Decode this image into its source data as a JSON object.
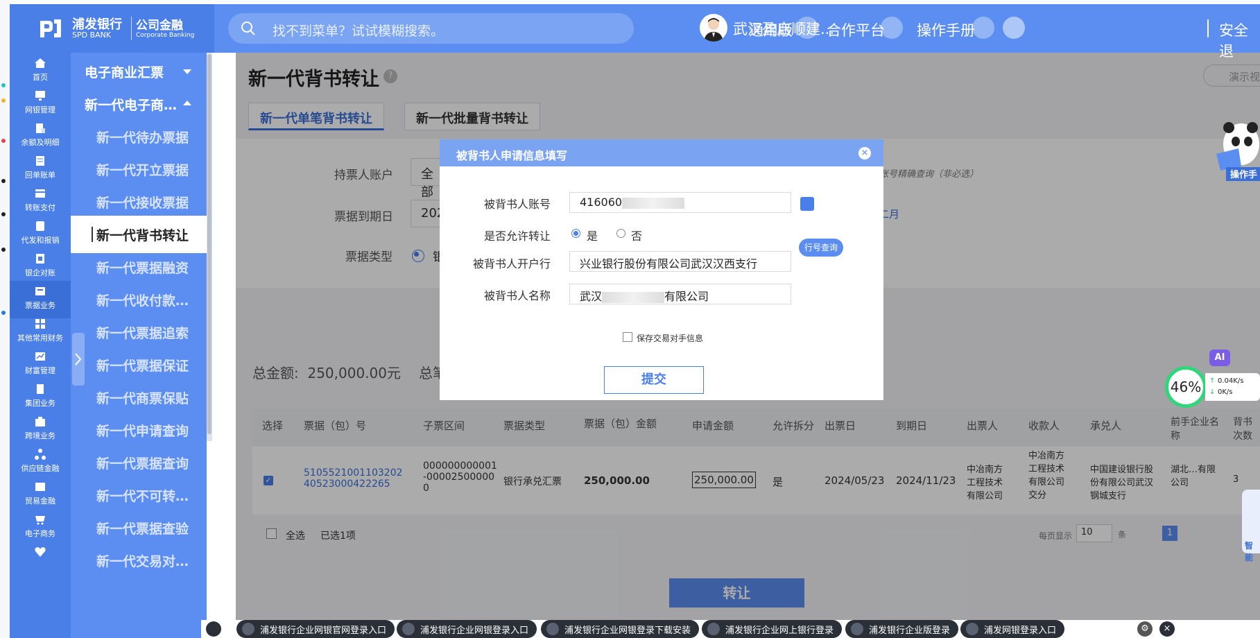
{
  "brand": {
    "name_cn": "浦发银行",
    "name_en": "SPD BANK",
    "sub_cn": "公司金融",
    "sub_en": "Corporate Banking"
  },
  "topbar": {
    "search_placeholder": "找不到菜单？试试模糊搜索。",
    "user_name": "武汉盈启顺建...",
    "version_label": "通用版",
    "partner_label": "合作平台",
    "manual_label": "操作手册",
    "logout_label": "安全退"
  },
  "icon_nav": [
    {
      "label": "首页",
      "icon": "home-icon"
    },
    {
      "label": "网银管理",
      "icon": "monitor-icon"
    },
    {
      "label": "余额及明细",
      "icon": "balance-icon"
    },
    {
      "label": "回单账单",
      "icon": "receipt-icon"
    },
    {
      "label": "转账支付",
      "icon": "transfer-icon"
    },
    {
      "label": "代发和报销",
      "icon": "payroll-icon"
    },
    {
      "label": "银企对账",
      "icon": "reconcile-icon"
    },
    {
      "label": "票据业务",
      "icon": "bill-icon"
    },
    {
      "label": "其他常用财务",
      "icon": "grid-icon"
    },
    {
      "label": "财富管理",
      "icon": "chart-icon"
    },
    {
      "label": "集团业务",
      "icon": "group-icon"
    },
    {
      "label": "跨境业务",
      "icon": "cross-border-icon"
    },
    {
      "label": "供应链金融",
      "icon": "supply-chain-icon"
    },
    {
      "label": "贸易金融",
      "icon": "trade-icon"
    },
    {
      "label": "电子商务",
      "icon": "ecommerce-icon"
    }
  ],
  "sub_nav": {
    "header": "电子商业汇票",
    "group": "新一代电子商…",
    "items": [
      "新一代待办票据",
      "新一代开立票据",
      "新一代接收票据",
      "新一代背书转让",
      "新一代票据融资",
      "新一代收付款…",
      "新一代票据追索",
      "新一代票据保证",
      "新一代商票保贴",
      "新一代申请查询",
      "新一代票据查询",
      "新一代不可转…",
      "新一代票据查验",
      "新一代交易对…"
    ]
  },
  "page": {
    "title": "新一代背书转让",
    "demo_label": "演示视",
    "tabs": [
      "新一代单笔背书转让",
      "新一代批量背书转让"
    ],
    "form": {
      "holder_account_label": "持票人账户",
      "holder_account_value": "全部",
      "due_date_label": "票据到期日",
      "due_date_value": "202",
      "bill_type_label": "票据类型",
      "bill_type_value": "银",
      "hint": "账号精确查询（非必选）",
      "month_hint": "二月"
    },
    "summary": {
      "total_label": "总金额:",
      "total_value": "250,000.00元",
      "count_label": "总笔"
    },
    "table": {
      "headers": [
        "选择",
        "票据（包）号",
        "子票区间",
        "票据类型",
        "票据（包）金额",
        "申请金额",
        "允许拆分",
        "出票日",
        "到期日",
        "出票人",
        "收款人",
        "承兑人",
        "前手企业名称",
        "背书次数"
      ],
      "row": {
        "bill_no": "510552100110320240523000422265",
        "range": "000000000001-000025000000",
        "bill_type": "银行承兑汇票",
        "amount": "250,000.00",
        "apply_amount": "250,000.00",
        "split": "是",
        "issue_date": "2024/05/23",
        "due_date": "2024/11/23",
        "drawer": "中冶南方工程技术有限公司",
        "payee": "中冶南方工程技术有限公司交分",
        "acceptor": "中国建设银行股份有限公司武汉钢城支行",
        "prior_holder": "湖北…有限公司",
        "endorse_count": "3"
      },
      "select_all": "全选",
      "selected_info": "已选1项",
      "page_size_label": "每页显示",
      "page_size_value": "10",
      "page_unit": "条",
      "current_page": "1"
    },
    "transfer_button": "转让"
  },
  "modal": {
    "title": "被背书人申请信息填写",
    "account_label": "被背书人账号",
    "account_value": "416060",
    "allow_transfer_label": "是否允许转让",
    "yes_label": "是",
    "no_label": "否",
    "bank_label": "被背书人开户行",
    "bank_value": "兴业银行股份有限公司武汉汉西支行",
    "bank_query_label": "行号查询",
    "name_label": "被背书人名称",
    "name_prefix": "武汉",
    "name_suffix": "有限公司",
    "save_label": "保存交易对手信息",
    "submit_label": "提交"
  },
  "widgets": {
    "mascot_label": "操作手",
    "ai_label": "AI",
    "perf_value": "46%",
    "upload_rate": "0.04K/s",
    "download_rate": "0K/s",
    "robot_label": "智能"
  },
  "taskbar": [
    "浦发银行企业网银官网登录入口",
    "浦发银行企业网银登录入口",
    "浦发银行企业网银登录下载安装",
    "浦发银行企业网上银行登录",
    "浦发银行企业版登录",
    "浦发网银登录入口"
  ],
  "colors": {
    "brand_blue": "#4a7fe8",
    "topbar_blue": "#5b8ef0",
    "modal_header": "#7aa4f2"
  }
}
